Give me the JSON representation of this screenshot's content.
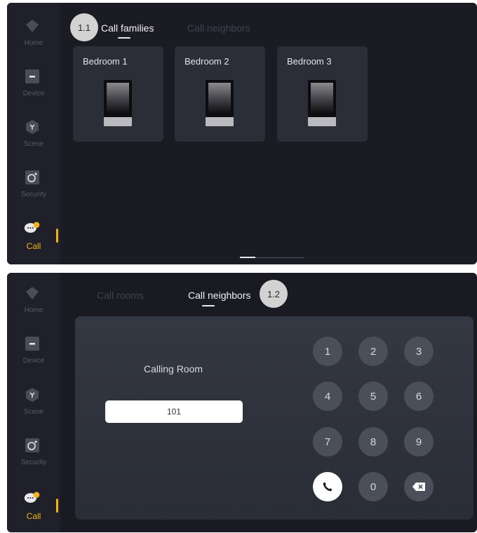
{
  "nav": [
    {
      "key": "home",
      "label": "Home",
      "icon": "home-icon"
    },
    {
      "key": "device",
      "label": "Device",
      "icon": "device-icon"
    },
    {
      "key": "scene",
      "label": "Scene",
      "icon": "scene-icon"
    },
    {
      "key": "security",
      "label": "Security",
      "icon": "security-icon"
    },
    {
      "key": "call",
      "label": "Call",
      "icon": "call-chat-icon",
      "active": true
    }
  ],
  "panel1": {
    "badge": "1.1",
    "tabs": [
      {
        "label": "Call families",
        "active": true
      },
      {
        "label": "Call neighbors",
        "active": false
      }
    ],
    "rooms": [
      {
        "name": "Bedroom 1"
      },
      {
        "name": "Bedroom 2"
      },
      {
        "name": "Bedroom 3"
      }
    ]
  },
  "panel2": {
    "badge": "1.2",
    "tabs": [
      {
        "label": "Call rooms",
        "active": false
      },
      {
        "label": "Call neighbors",
        "active": true
      }
    ],
    "calling_label": "Calling Room",
    "room_value": "101",
    "keypad": [
      "1",
      "2",
      "3",
      "4",
      "5",
      "6",
      "7",
      "8",
      "9",
      "call",
      "0",
      "backspace"
    ]
  },
  "colors": {
    "accent": "#f3b31a",
    "panel_bg": "#1b1b23",
    "card_bg": "#2b2e37",
    "key_bg": "#4b4f5a"
  }
}
